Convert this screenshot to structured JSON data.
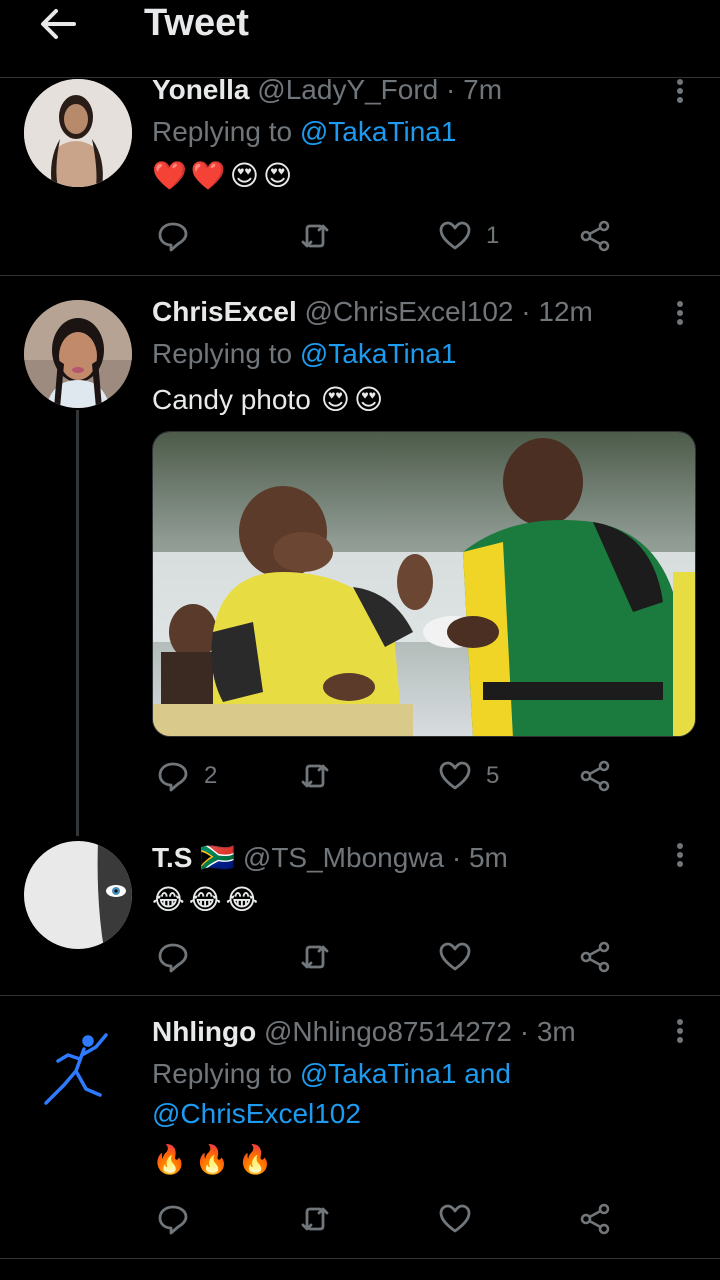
{
  "header": {
    "title": "Tweet",
    "back_icon": "arrow-left-icon"
  },
  "tweets": [
    {
      "name": "Yonella",
      "handle": "@LadyY_Ford",
      "dot": "·",
      "time": "7m",
      "replying_prefix": "Replying to",
      "replying_to": "@TakaTina1",
      "text": "",
      "emojis": [
        "❤️",
        "❤️",
        "😍",
        "😍"
      ],
      "actions": {
        "reply_count": "",
        "retweet_count": "",
        "like_count": "1"
      }
    },
    {
      "name": "ChrisExcel",
      "handle": "@ChrisExcel102",
      "dot": "·",
      "time": "12m",
      "replying_prefix": "Replying to",
      "replying_to": "@TakaTina1",
      "text": "Candy photo",
      "emojis": [
        "😍",
        "😍"
      ],
      "actions": {
        "reply_count": "2",
        "retweet_count": "",
        "like_count": "5"
      }
    },
    {
      "name": "T.S",
      "flag": "🇿🇦",
      "handle": "@TS_Mbongwa",
      "dot": "·",
      "time": "5m",
      "emojis": [
        "😂",
        "😂",
        "😂"
      ],
      "actions": {
        "reply_count": "",
        "retweet_count": "",
        "like_count": ""
      }
    },
    {
      "name": "Nhlingo",
      "handle": "@Nhlingo87514272",
      "dot": "·",
      "time": "3m",
      "replying_prefix": "Replying to",
      "replying_to": "@TakaTina1 and",
      "replying_to_2": "@ChrisExcel102",
      "emojis": [
        "🔥",
        "🔥",
        "🔥"
      ],
      "actions": {
        "reply_count": "",
        "retweet_count": "",
        "like_count": ""
      }
    }
  ],
  "colors": {
    "background": "#000000",
    "text": "#e7e9ea",
    "muted": "#71767b",
    "link": "#1d9bf0",
    "divider": "#2f3336"
  }
}
